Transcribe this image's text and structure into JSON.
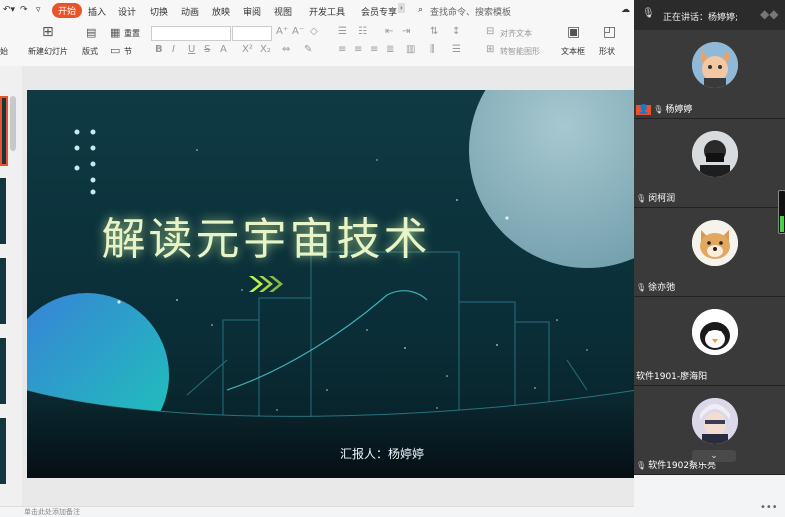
{
  "menubar": {
    "items": [
      "开始",
      "插入",
      "设计",
      "切换",
      "动画",
      "放映",
      "审阅",
      "视图",
      "开发工具",
      "会员专享"
    ],
    "active": "开始",
    "search_placeholder": "查找命令、搜索模板"
  },
  "ribbon": {
    "left_partial": "始",
    "new_slide": "新建幻灯片",
    "layout": "版式",
    "section": "节",
    "reset": "重置",
    "align_text": "对齐文本",
    "smart_art": "转智能图形",
    "textbox": "文本框",
    "shape": "形状"
  },
  "slide": {
    "title": "解读元宇宙技术",
    "reporter": "汇报人：杨婷婷"
  },
  "notes_placeholder": "单击此处添加备注",
  "meeting": {
    "speaking": "正在讲话：杨婷婷;",
    "participants": [
      {
        "name": "杨婷婷",
        "avatar": "cat-face-avatar"
      },
      {
        "name": "闵柯润",
        "avatar": "masked-person-avatar"
      },
      {
        "name": "徐亦弛",
        "avatar": "shiba-dog-avatar"
      },
      {
        "name": "软件1901-廖海阳",
        "avatar": "penguin-meme-avatar"
      },
      {
        "name": "软件1902蔡乐亮",
        "avatar": "anime-character-avatar"
      }
    ],
    "volume_level": 0.4
  },
  "colors": {
    "accent": "#e8532a",
    "slide_bg": "#0f3a42",
    "title_glow": "#e6f4c8",
    "chevron": "#c8ff4a"
  }
}
